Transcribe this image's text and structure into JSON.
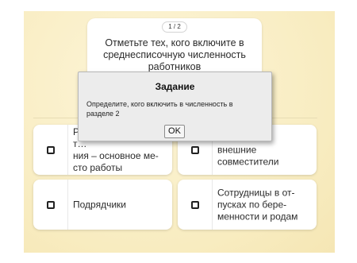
{
  "corner_icon": "expand-icon",
  "question": {
    "counter": "1 / 2",
    "text": "Отметьте тех, кого включите в среднесписочную численность работников"
  },
  "options": [
    {
      "label": "Работники, для которых организация – основное место работы",
      "visible_label": "Р… т… ния – основное ме-сто работы",
      "checked": false
    },
    {
      "label": "Внешние совместители",
      "visible_label": "внешние совместители",
      "checked": false
    },
    {
      "label": "Подрядчики",
      "visible_label": "Подрядчики",
      "checked": false
    },
    {
      "label": "Сотрудницы в отпусках по беременности и родам",
      "visible_label": "Сотрудницы в от-пусках по бере-менности и родам",
      "checked": false
    }
  ],
  "dialog": {
    "title": "Задание",
    "message": "Определите, кого включить в численность в разделе 2",
    "ok_label": "OK"
  },
  "colors": {
    "background": "#fbf0c9",
    "card": "#ffffff",
    "dialog": "#ececec"
  }
}
